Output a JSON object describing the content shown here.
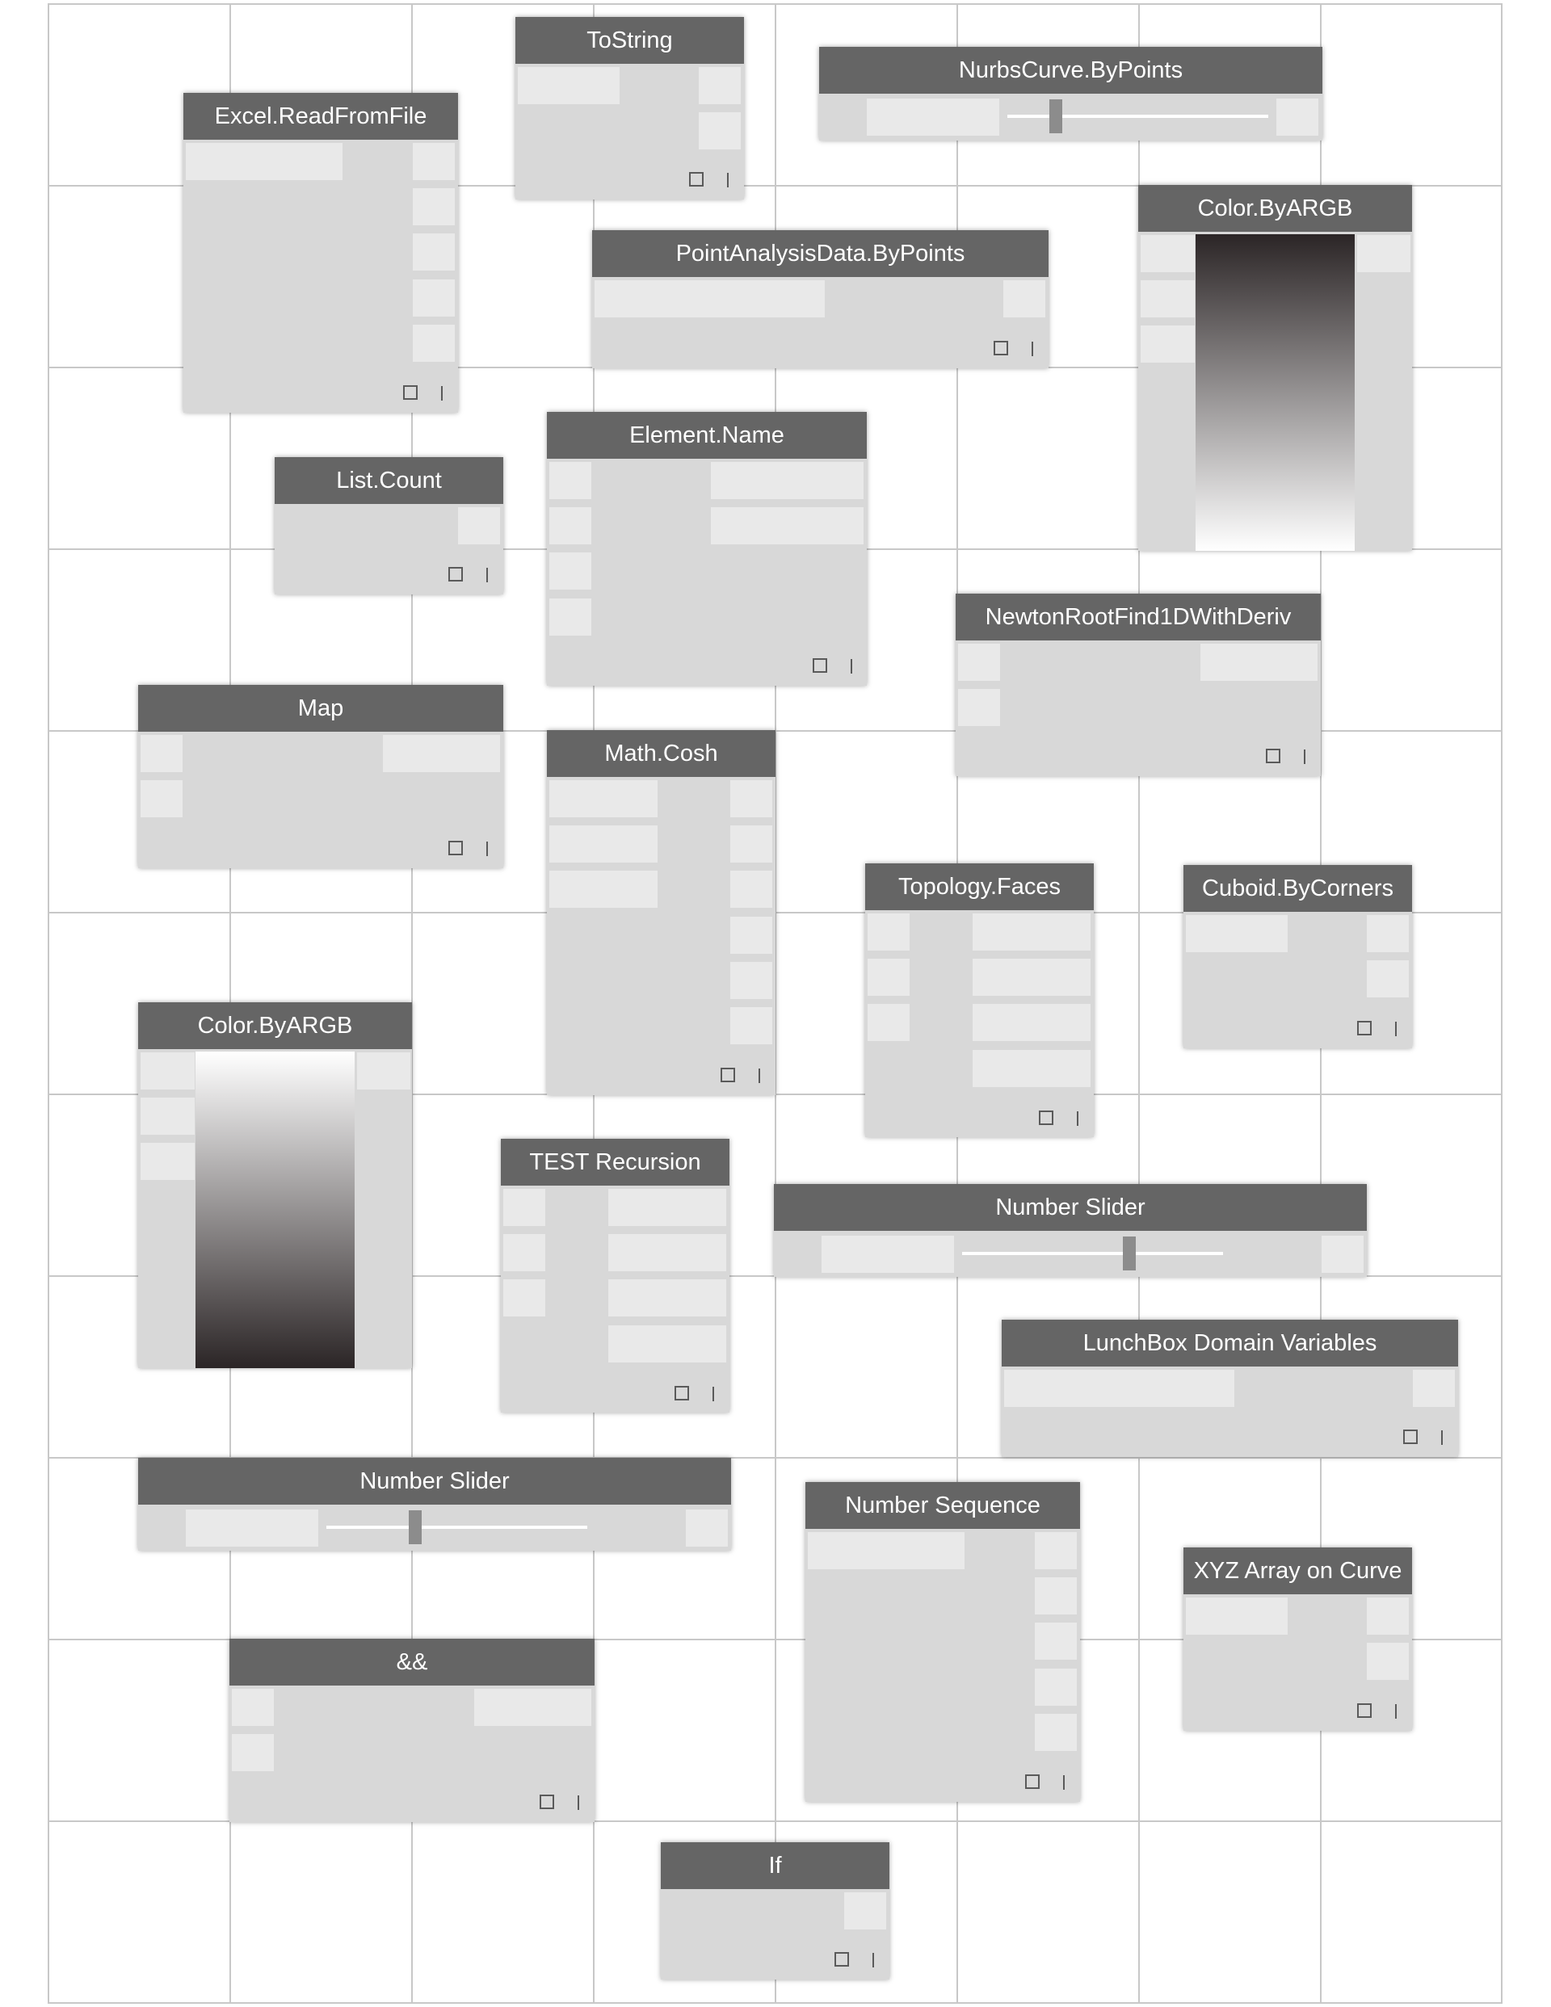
{
  "canvas": {
    "nodes": {
      "excel_read": {
        "title": "Excel.ReadFromFile"
      },
      "to_string": {
        "title": "ToString"
      },
      "nurbs_curve": {
        "title": "NurbsCurve.ByPoints"
      },
      "point_analysis": {
        "title": "PointAnalysisData.ByPoints"
      },
      "color_argb_top": {
        "title": "Color.ByARGB"
      },
      "list_count": {
        "title": "List.Count"
      },
      "element_name": {
        "title": "Element.Name"
      },
      "newton_root": {
        "title": "NewtonRootFind1DWithDeriv"
      },
      "map": {
        "title": "Map"
      },
      "math_cosh": {
        "title": "Math.Cosh"
      },
      "topology_faces": {
        "title": "Topology.Faces"
      },
      "cuboid_corners": {
        "title": "Cuboid.ByCorners"
      },
      "color_argb_left": {
        "title": "Color.ByARGB"
      },
      "test_recursion": {
        "title": "TEST Recursion"
      },
      "number_slider_mid": {
        "title": "Number Slider",
        "value_fraction": 0.64
      },
      "lunchbox_domain": {
        "title": "LunchBox Domain Variables"
      },
      "number_slider_left": {
        "title": "Number Slider",
        "value_fraction": 0.34
      },
      "number_sequence": {
        "title": "Number Sequence"
      },
      "xyz_array": {
        "title": "XYZ Array on Curve"
      },
      "and_node": {
        "title": "&&"
      },
      "if_node": {
        "title": "If"
      }
    },
    "colors": {
      "header": "#656565",
      "body": "#d8d8d8",
      "port": "#e9e9e9",
      "grid": "#c8c8c8",
      "gradient_dark": "#2b2526"
    }
  }
}
